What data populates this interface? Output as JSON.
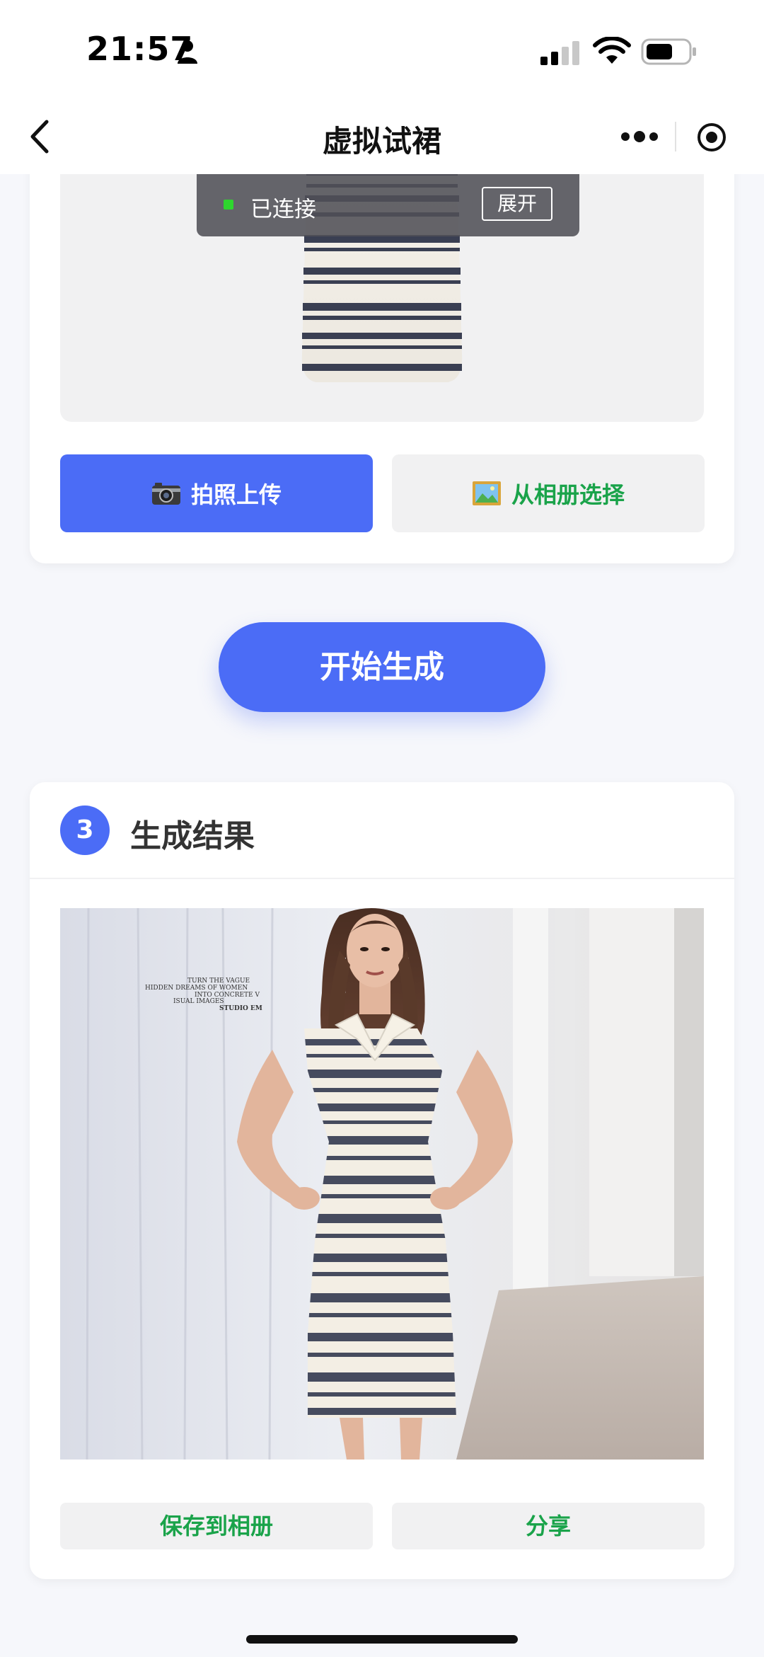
{
  "status_bar": {
    "time": "21:57",
    "icons": [
      "person-icon",
      "signal-icon",
      "wifi-icon",
      "battery-icon"
    ]
  },
  "nav": {
    "title": "虚拟试裙",
    "icons": [
      "back-icon",
      "more-icon",
      "target-icon"
    ]
  },
  "connection": {
    "status_text": "已连接",
    "expand_label": "展开",
    "dot_color": "#2ed62e"
  },
  "upload": {
    "camera_icon": "📷",
    "camera_label": "拍照上传",
    "album_icon": "🖼️",
    "album_label": "从相册选择"
  },
  "start_button_label": "开始生成",
  "result": {
    "step_number": "3",
    "title": "生成结果",
    "image_caption_lines": [
      "TURN THE VAGUE",
      "HIDDEN DREAMS OF WOMEN",
      "INTO CONCRETE V",
      "ISUAL IMAGES",
      "STUDIO EM"
    ],
    "save_label": "保存到相册",
    "share_label": "分享"
  },
  "colors": {
    "accent": "#4b6cf6",
    "green_text": "#1aa34a",
    "connect_bg": "#505056"
  }
}
